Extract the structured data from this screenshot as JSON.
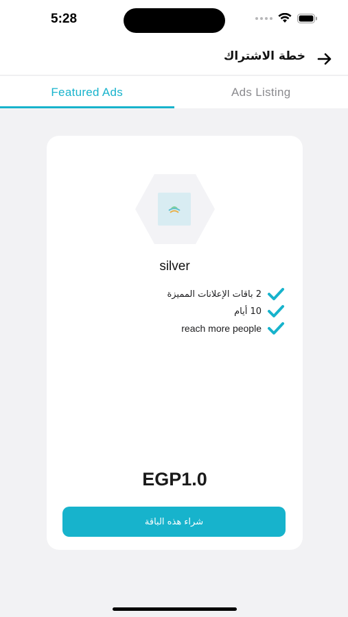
{
  "status_bar": {
    "time": "5:28",
    "icons": [
      "signal-dots-icon",
      "wifi-icon",
      "battery-icon"
    ]
  },
  "header": {
    "title": "خطة الاشتراك",
    "back_icon": "arrow-right-icon"
  },
  "tabs": [
    {
      "label": "Featured Ads",
      "active": true
    },
    {
      "label": "Ads Listing",
      "active": false
    }
  ],
  "plan": {
    "name": "silver",
    "logo_icon": "app-logo-icon",
    "features": [
      {
        "text": "2 باقات الإعلانات المميزة",
        "icon": "check-icon"
      },
      {
        "text": "10 أيام",
        "icon": "check-icon"
      },
      {
        "text": "reach more people",
        "icon": "check-icon"
      }
    ],
    "price": "EGP1.0",
    "buy_label": "شراء هذه الباقة"
  },
  "colors": {
    "accent": "#17b3cc",
    "background": "#f2f2f4",
    "card": "#ffffff"
  }
}
